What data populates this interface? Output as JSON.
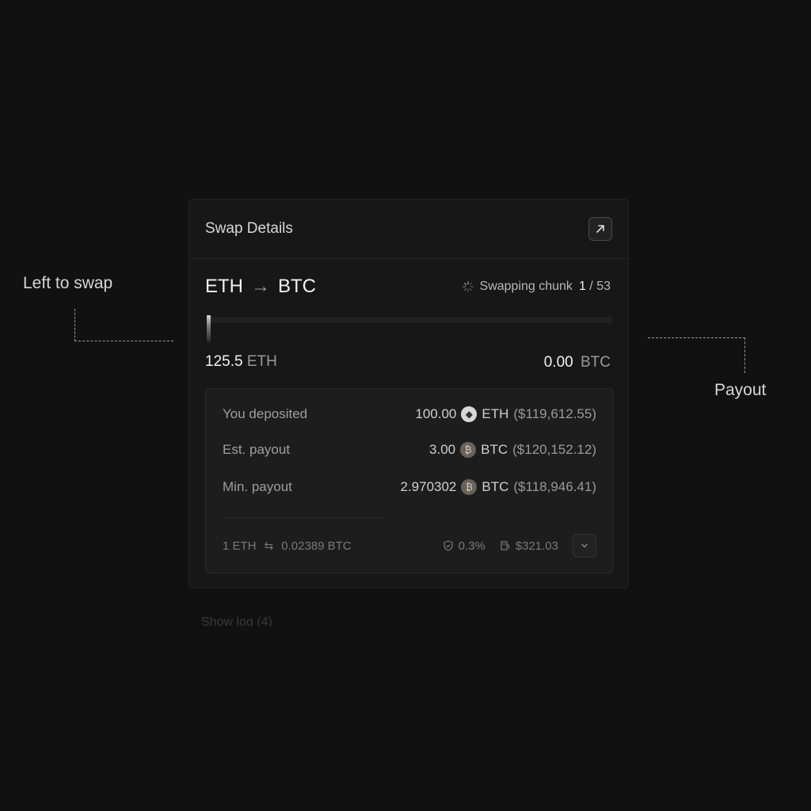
{
  "callouts": {
    "left": "Left to swap",
    "right": "Payout"
  },
  "card": {
    "title": "Swap Details",
    "pair": {
      "from": "ETH",
      "arrow": "→",
      "to": "BTC"
    },
    "status": {
      "label": "Swapping chunk",
      "current": "1",
      "separator": "/",
      "total": "53"
    },
    "progress_fraction": 0.01,
    "left_amount": {
      "value": "125.5",
      "unit": "ETH"
    },
    "payout_amount": {
      "value": "0.00",
      "unit": "BTC"
    },
    "details": {
      "rows": [
        {
          "label": "You deposited",
          "amount": "100.00",
          "coin": "eth-icon",
          "unit": "ETH",
          "usd": "($119,612.55)"
        },
        {
          "label": "Est. payout",
          "amount": "3.00",
          "coin": "btc-icon",
          "unit": "BTC",
          "usd": "($120,152.12)"
        },
        {
          "label": "Min. payout",
          "amount": "2.970302",
          "coin": "btc-icon",
          "unit": "BTC",
          "usd": "($118,946.41)"
        }
      ],
      "footer": {
        "rate_from": "1 ETH",
        "rate_to": "0.02389 BTC",
        "slippage": "0.3%",
        "fee": "$321.03"
      }
    }
  },
  "show_log": "Show log (4)"
}
